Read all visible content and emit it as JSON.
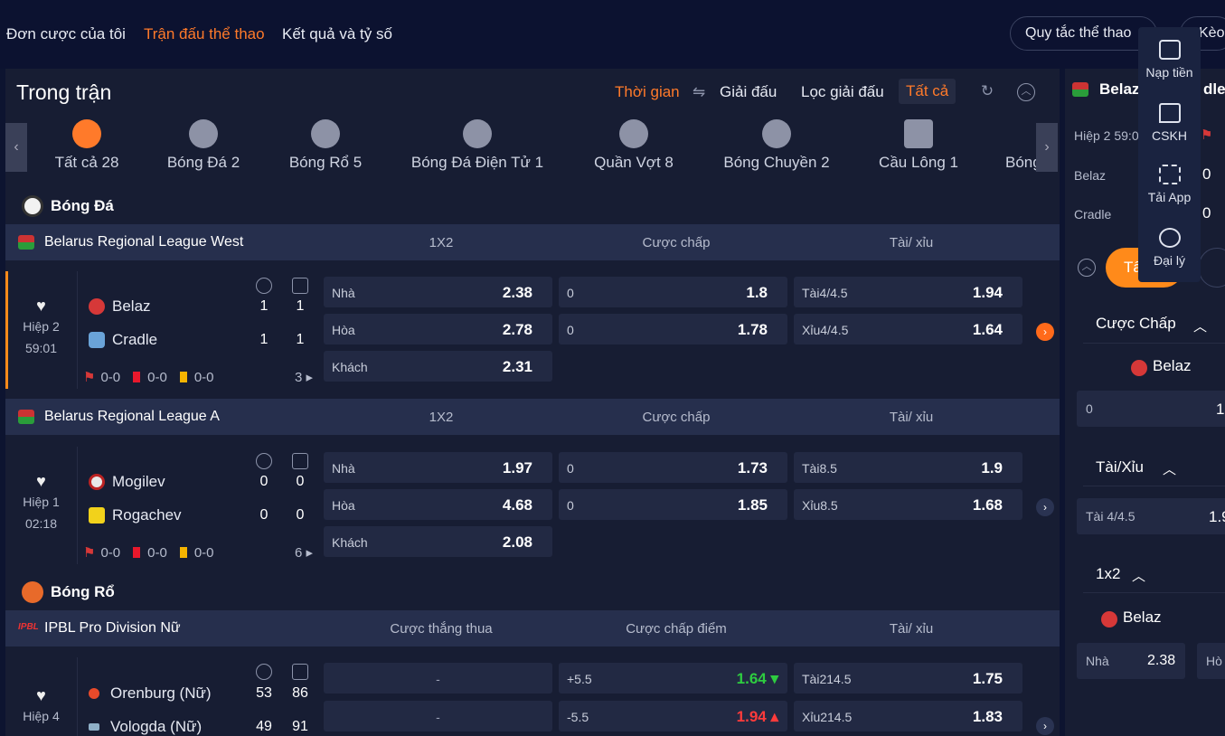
{
  "topnav": {
    "tabs": [
      {
        "label": "Đơn cược của tôi",
        "active": false
      },
      {
        "label": "Trận đấu thể thao",
        "active": true
      },
      {
        "label": "Kết quả và tỷ số",
        "active": false
      }
    ],
    "rules_button": "Quy tắc thể thao",
    "odds_button": "Kèo"
  },
  "main": {
    "title": "Trong trận",
    "filters": {
      "time": "Thời gian",
      "tournament": "Giải đấu",
      "filter_tournament": "Lọc giải đấu",
      "all": "Tất cả"
    },
    "sports": [
      {
        "label": "Tất cả 28",
        "icon": "all-icon",
        "active": true
      },
      {
        "label": "Bóng Đá 2",
        "icon": "soccer-icon",
        "active": false
      },
      {
        "label": "Bóng Rổ 5",
        "icon": "basketball-icon",
        "active": false
      },
      {
        "label": "Bóng Đá Điện Tử 1",
        "icon": "esoccer-icon",
        "active": false
      },
      {
        "label": "Quần Vợt 8",
        "icon": "tennis-icon",
        "active": false
      },
      {
        "label": "Bóng Chuyền 2",
        "icon": "volleyball-icon",
        "active": false
      },
      {
        "label": "Cầu Lông 1",
        "icon": "badminton-icon",
        "active": false
      },
      {
        "label": "Bóng",
        "icon": "more-sport-icon",
        "active": false
      }
    ],
    "sections": {
      "soccer": "Bóng Đá",
      "basketball": "Bóng Rổ"
    },
    "leagues": [
      {
        "name": "Belarus Regional League West",
        "col1": "1X2",
        "col2": "Cược chấp",
        "col3": "Tài/ xỉu"
      },
      {
        "name": "Belarus Regional League A",
        "col1": "1X2",
        "col2": "Cược chấp",
        "col3": "Tài/ xỉu"
      },
      {
        "name": "IPBL Pro Division Nữ",
        "col1": "Cược thắng thua",
        "col2": "Cược chấp điểm",
        "col3": "Tài/ xỉu"
      }
    ],
    "matches": [
      {
        "period": "Hiệp 2",
        "clock": "59:01",
        "home": "Belaz",
        "away": "Cradle",
        "home_s1": "1",
        "home_s2": "1",
        "away_s1": "1",
        "away_s2": "1",
        "corners": "0-0",
        "red": "0-0",
        "yellow": "0-0",
        "more": "3",
        "x12": [
          {
            "l": "Nhà",
            "v": "2.38"
          },
          {
            "l": "Hòa",
            "v": "2.78"
          },
          {
            "l": "Khách",
            "v": "2.31"
          }
        ],
        "hdp": [
          {
            "l": "0",
            "v": "1.8"
          },
          {
            "l": "0",
            "v": "1.78"
          }
        ],
        "ou": [
          {
            "l": "Tài4/4.5",
            "v": "1.94"
          },
          {
            "l": "Xỉu4/4.5",
            "v": "1.64"
          }
        ]
      },
      {
        "period": "Hiệp 1",
        "clock": "02:18",
        "home": "Mogilev",
        "away": "Rogachev",
        "home_s1": "0",
        "home_s2": "0",
        "away_s1": "0",
        "away_s2": "0",
        "corners": "0-0",
        "red": "0-0",
        "yellow": "0-0",
        "more": "6",
        "x12": [
          {
            "l": "Nhà",
            "v": "1.97"
          },
          {
            "l": "Hòa",
            "v": "4.68"
          },
          {
            "l": "Khách",
            "v": "2.08"
          }
        ],
        "hdp": [
          {
            "l": "0",
            "v": "1.73"
          },
          {
            "l": "0",
            "v": "1.85"
          }
        ],
        "ou": [
          {
            "l": "Tài8.5",
            "v": "1.9"
          },
          {
            "l": "Xỉu8.5",
            "v": "1.68"
          }
        ]
      },
      {
        "period": "Hiệp 4",
        "home": "Orenburg (Nữ)",
        "away": "Vologda (Nữ)",
        "home_s1": "53",
        "home_s2": "86",
        "away_s1": "49",
        "away_s2": "91",
        "ml": [
          {
            "v": "-"
          },
          {
            "v": "-"
          }
        ],
        "hdp": [
          {
            "l": "+5.5",
            "v": "1.64 ▾"
          },
          {
            "l": "-5.5",
            "v": "1.94 ▴"
          }
        ],
        "ou": [
          {
            "l": "Tài214.5",
            "v": "1.75"
          },
          {
            "l": "Xỉu214.5",
            "v": "1.83"
          }
        ]
      }
    ]
  },
  "right": {
    "match_title": "Belaz",
    "match_title_tail": "dle",
    "period": "Hiệp 2 59:0",
    "home": "Belaz",
    "home_score": "0",
    "away": "Cradle",
    "away_score": "0",
    "tab_label": "Tấ",
    "sections": {
      "handicap": "Cược Chấp",
      "ou": "Tài/Xỉu",
      "x12": "1x2"
    },
    "handicap_team": "Belaz",
    "handicap_line": "0",
    "handicap_val": "1",
    "ou_line": "Tài 4/4.5",
    "ou_val": "1.9",
    "x12_team": "Belaz",
    "x12_home_label": "Nhà",
    "x12_home_val": "2.38",
    "x12_draw_label": "Hò"
  },
  "sidemenu": [
    {
      "label": "Nạp tiền",
      "icon": "wallet-icon"
    },
    {
      "label": "CSKH",
      "icon": "chat-icon"
    },
    {
      "label": "Tải App",
      "icon": "qr-code-icon"
    },
    {
      "label": "Đại lý",
      "icon": "agent-icon"
    }
  ],
  "colors": {
    "accent": "#ff7a2a",
    "background": "#0d1430",
    "panel": "#171d33",
    "league_bar": "#262f4d",
    "odd_box": "#222943"
  }
}
